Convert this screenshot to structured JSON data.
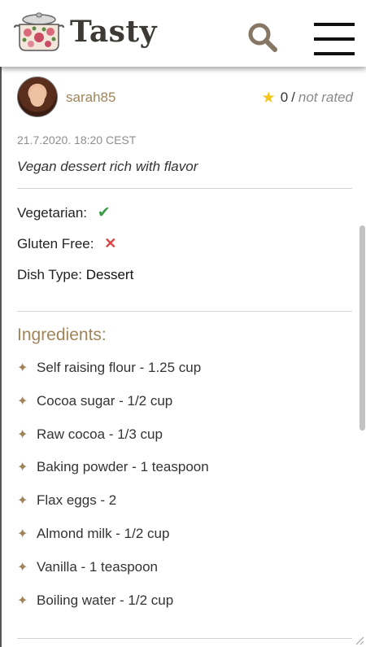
{
  "header": {
    "app_name": "Tasty",
    "logo_icon": "flower-pot-icon",
    "search_icon": "search-icon",
    "menu_icon": "hamburger-menu-icon"
  },
  "post": {
    "username": "sarah85",
    "rating_count": "0",
    "rating_separator": "/",
    "rating_status": "not rated",
    "timestamp": "21.7.2020. 18:20 CEST",
    "description": "Vegan dessert rich with flavor"
  },
  "attributes": {
    "vegetarian_label": "Vegetarian:",
    "vegetarian_value": true,
    "gluten_free_label": "Gluten Free:",
    "gluten_free_value": false,
    "dish_type_label": "Dish Type:",
    "dish_type_value": "Dessert"
  },
  "ingredients": {
    "title": "Ingredients:",
    "items": [
      "Self raising flour - 1.25 cup",
      "Cocoa sugar - 1/2 cup",
      "Raw cocoa - 1/3 cup",
      "Baking powder - 1 teaspoon",
      "Flax eggs - 2",
      "Almond milk - 1/2 cup",
      "Vanilla - 1 teaspoon",
      "Boiling water - 1/2 cup"
    ]
  },
  "colors": {
    "accent": "#a0855a",
    "check": "#3a9a47",
    "cross": "#d84646",
    "star": "#f5c518"
  }
}
